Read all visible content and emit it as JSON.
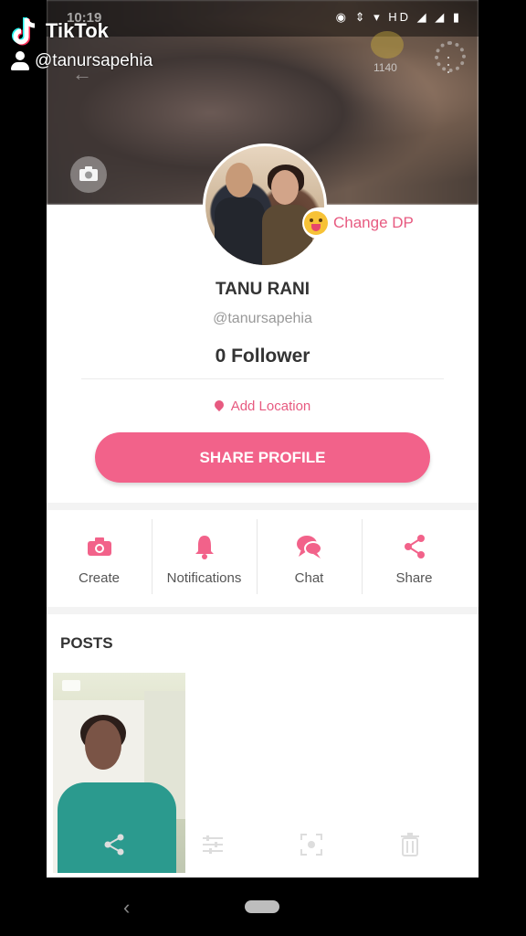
{
  "status_bar": {
    "time": "10:19",
    "network": "HD"
  },
  "tiktok": {
    "brand": "TikTok",
    "username": "@tanursapehia"
  },
  "cover": {
    "coin_count": "1140"
  },
  "profile": {
    "change_dp_label": "Change DP",
    "name": "TANU RANI",
    "handle": "@tanursapehia",
    "followers": "0 Follower",
    "location_label": "Add Location",
    "share_button": "SHARE PROFILE"
  },
  "actions": [
    {
      "label": "Create",
      "icon": "camera-icon"
    },
    {
      "label": "Notifications",
      "icon": "bell-icon"
    },
    {
      "label": "Chat",
      "icon": "chat-icon"
    },
    {
      "label": "Share",
      "icon": "share-icon"
    }
  ],
  "posts": {
    "title": "POSTS"
  },
  "colors": {
    "accent": "#f2628a",
    "accent_text": "#e75a80"
  }
}
